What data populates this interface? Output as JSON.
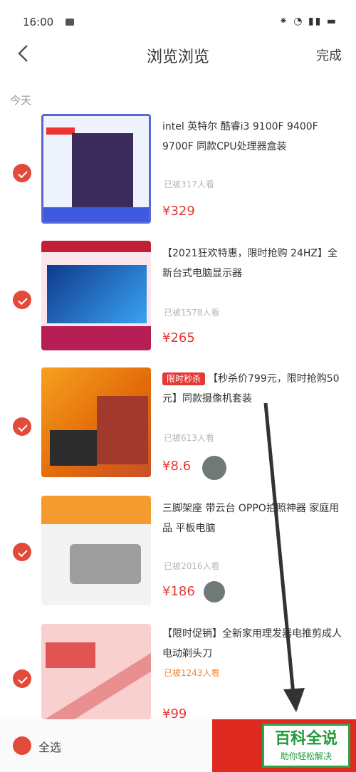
{
  "status_bar": {
    "time": "16:00",
    "icons_text": "⁕ ◔ ▮▮ ▬"
  },
  "nav": {
    "title": "浏览浏览",
    "done_label": "完成"
  },
  "section": {
    "label": "今天"
  },
  "items": [
    {
      "title": "intel 英特尔 酷睿i3 9100F 9400F 9700F 同款CPU处理器盒装",
      "tag": "",
      "sub": "已被317人看",
      "price": "¥329"
    },
    {
      "title": "【2021狂欢特惠，限时抢购 24HZ】全新台式电脑显示器",
      "tag": "",
      "sub": "已被1578人看",
      "price": "¥265"
    },
    {
      "title": "【秒杀价799元，限时抢购50元】同款摄像机套装",
      "tag": "限时秒杀",
      "sub": "已被613人看",
      "price": "¥8.6"
    },
    {
      "title": "三脚架座 带云台 OPPO拍照神器 家庭用品 平板电脑",
      "tag": "",
      "sub": "已被2016人看",
      "price": "¥186"
    },
    {
      "title": "【限时促销】全新家用理发器电推剪成人电动剃头刀",
      "tag": "",
      "sub": "已被1243人看",
      "price": "¥99"
    }
  ],
  "bottom": {
    "select_all_label": "全选",
    "delete_label": ""
  },
  "watermark": {
    "title": "百科全说",
    "subtitle": "助你轻松解决"
  },
  "colors": {
    "accent": "#e02a21",
    "radio": "#e24a3b",
    "price": "#e53935",
    "watermark": "#1f9a3b"
  }
}
